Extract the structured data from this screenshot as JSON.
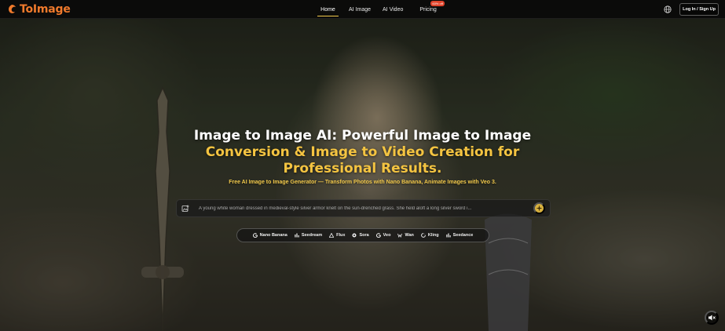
{
  "brand": {
    "name": "ToImage",
    "accent": "#f07a2c"
  },
  "nav": {
    "items": [
      {
        "label": "Home",
        "active": true
      },
      {
        "label": "AI Image"
      },
      {
        "label": "AI Video"
      },
      {
        "label": "Pricing",
        "badge": "60% off"
      }
    ],
    "login_label": "Log In / Sign Up",
    "globe_icon": "globe-icon"
  },
  "hero": {
    "title_white": "Image to Image AI: Powerful Image to Image",
    "title_gold_1": "Conversion & Image to Video Creation for",
    "title_gold_2": "Professional Results.",
    "subtitle": "Free AI Image to Image Generator — Transform Photos with Nano Banana, Animate Images with Veo 3.",
    "gold": "#f4c441"
  },
  "prompt": {
    "text": "A young white woman dressed in medieval-style silver armor knelt on the sun-drenched grass. She held aloft a long silver sword i...",
    "upload_icon": "image-upload-icon",
    "generate_icon": "sparkle-icon"
  },
  "models": [
    {
      "label": "Nano Banana",
      "icon": "google-g-icon"
    },
    {
      "label": "Seedream",
      "icon": "bars-icon"
    },
    {
      "label": "Flux",
      "icon": "triangle-icon"
    },
    {
      "label": "Sora",
      "icon": "openai-icon"
    },
    {
      "label": "Veo",
      "icon": "google-g-icon"
    },
    {
      "label": "Wan",
      "icon": "wan-icon"
    },
    {
      "label": "Kling",
      "icon": "kling-icon"
    },
    {
      "label": "Seedance",
      "icon": "bars-icon"
    }
  ],
  "mute_icon": "speaker-muted-icon"
}
